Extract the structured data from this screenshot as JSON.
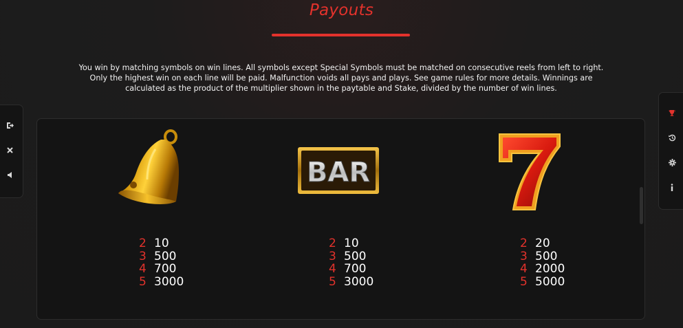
{
  "header": {
    "title": "Payouts"
  },
  "rules_text": "You win by matching symbols on win lines. All symbols except Special Symbols must be matched on consecutive reels from left to right. Only the highest win on each line will be paid. Malfunction voids all pays and plays. See game rules for more details. Winnings are calculated as the product of the multiplier shown in the paytable and Stake, divided by the number of win lines.",
  "left_toolbar": {
    "items": [
      {
        "icon": "exit-icon",
        "glyph": "⇥"
      },
      {
        "icon": "close-icon",
        "glyph": "✕"
      },
      {
        "icon": "sound-icon",
        "glyph": "◀"
      }
    ]
  },
  "right_toolbar": {
    "items": [
      {
        "icon": "trophy-icon",
        "glyph": "🏆"
      },
      {
        "icon": "history-icon",
        "glyph": "↺"
      },
      {
        "icon": "settings-icon",
        "glyph": "⚙"
      },
      {
        "icon": "info-icon",
        "glyph": "i"
      }
    ]
  },
  "colors": {
    "accent": "#e3322c",
    "background": "#1c1c1c",
    "panel": "#141414",
    "text": "#ffffff"
  },
  "symbols": [
    {
      "name": "bell",
      "icon": "bell-icon",
      "payouts": [
        {
          "count": "2",
          "value": "10"
        },
        {
          "count": "3",
          "value": "500"
        },
        {
          "count": "4",
          "value": "700"
        },
        {
          "count": "5",
          "value": "3000"
        }
      ]
    },
    {
      "name": "bar",
      "icon": "bar-icon",
      "label": "BAR",
      "payouts": [
        {
          "count": "2",
          "value": "10"
        },
        {
          "count": "3",
          "value": "500"
        },
        {
          "count": "4",
          "value": "700"
        },
        {
          "count": "5",
          "value": "3000"
        }
      ]
    },
    {
      "name": "seven",
      "icon": "seven-icon",
      "label": "7",
      "payouts": [
        {
          "count": "2",
          "value": "20"
        },
        {
          "count": "3",
          "value": "500"
        },
        {
          "count": "4",
          "value": "2000"
        },
        {
          "count": "5",
          "value": "5000"
        }
      ]
    }
  ]
}
